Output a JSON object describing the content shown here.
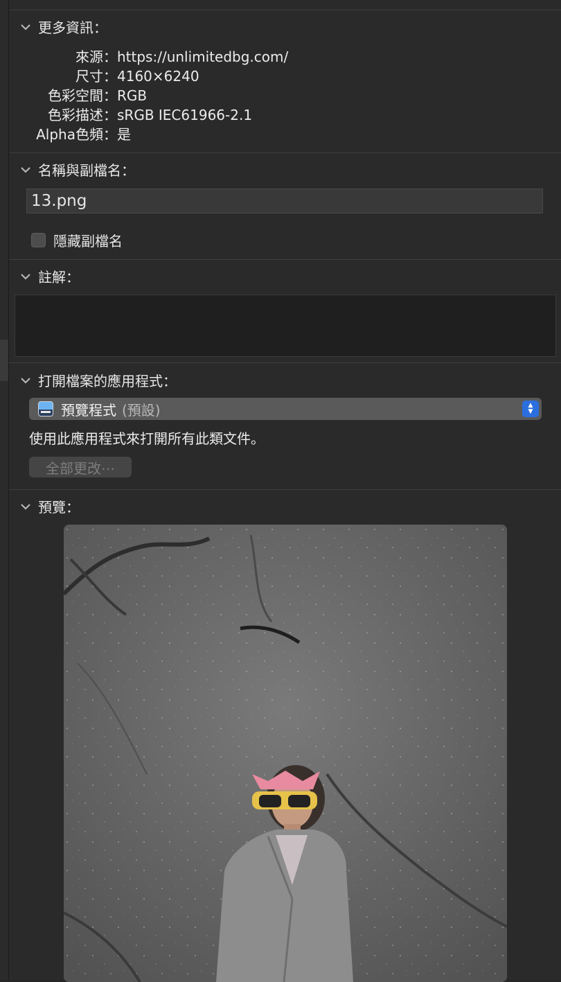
{
  "more_info": {
    "title": "更多資訊：",
    "rows": [
      {
        "key": "來源：",
        "value": "https://unlimitedbg.com/"
      },
      {
        "key": "尺寸：",
        "value": "4160×6240"
      },
      {
        "key": "色彩空間：",
        "value": "RGB"
      },
      {
        "key": "色彩描述：",
        "value": "sRGB IEC61966-2.1"
      },
      {
        "key": "Alpha色頻：",
        "value": "是"
      }
    ]
  },
  "name_ext": {
    "title": "名稱與副檔名：",
    "filename": "13.png",
    "hide_extension_label": "隱藏副檔名"
  },
  "comments": {
    "title": "註解：",
    "value": ""
  },
  "open_with": {
    "title": "打開檔案的應用程式：",
    "app_name": "預覽程式",
    "app_note": "(預設)",
    "description": "使用此應用程式來打開所有此類文件。",
    "change_all_label": "全部更改⋯"
  },
  "preview": {
    "title": "預覽："
  },
  "colors": {
    "accent": "#2b6fde",
    "background": "#2a2a2a"
  },
  "icons": {
    "disclosure": "chevron-down-icon",
    "app": "preview-app-icon",
    "popup": "up-down-stepper-icon"
  }
}
